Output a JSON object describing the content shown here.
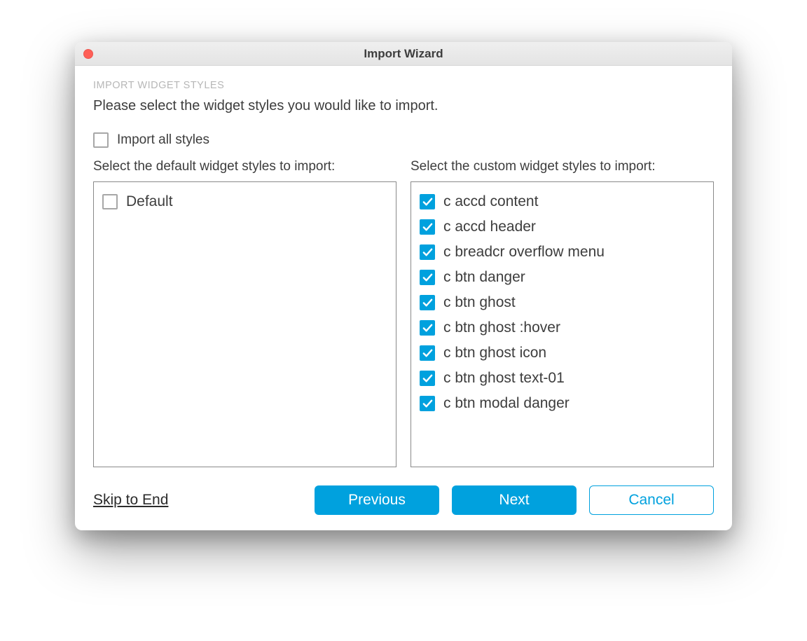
{
  "window": {
    "title": "Import Wizard"
  },
  "section": {
    "label": "Import Widget Styles",
    "description": "Please select the widget styles you would like to import."
  },
  "import_all": {
    "label": "Import all styles",
    "checked": false
  },
  "columns": {
    "default": {
      "heading": "Select the default widget styles to import:",
      "items": [
        {
          "label": "Default",
          "checked": false
        }
      ]
    },
    "custom": {
      "heading": "Select the custom widget styles to import:",
      "items": [
        {
          "label": "c accd content",
          "checked": true
        },
        {
          "label": "c accd header",
          "checked": true
        },
        {
          "label": "c breadcr overflow menu",
          "checked": true
        },
        {
          "label": "c btn danger",
          "checked": true
        },
        {
          "label": "c btn ghost",
          "checked": true
        },
        {
          "label": "c btn ghost :hover",
          "checked": true
        },
        {
          "label": "c btn ghost icon",
          "checked": true
        },
        {
          "label": "c btn ghost text-01",
          "checked": true
        },
        {
          "label": "c btn modal danger",
          "checked": true
        }
      ]
    }
  },
  "footer": {
    "skip": "Skip to End",
    "previous": "Previous",
    "next": "Next",
    "cancel": "Cancel"
  }
}
